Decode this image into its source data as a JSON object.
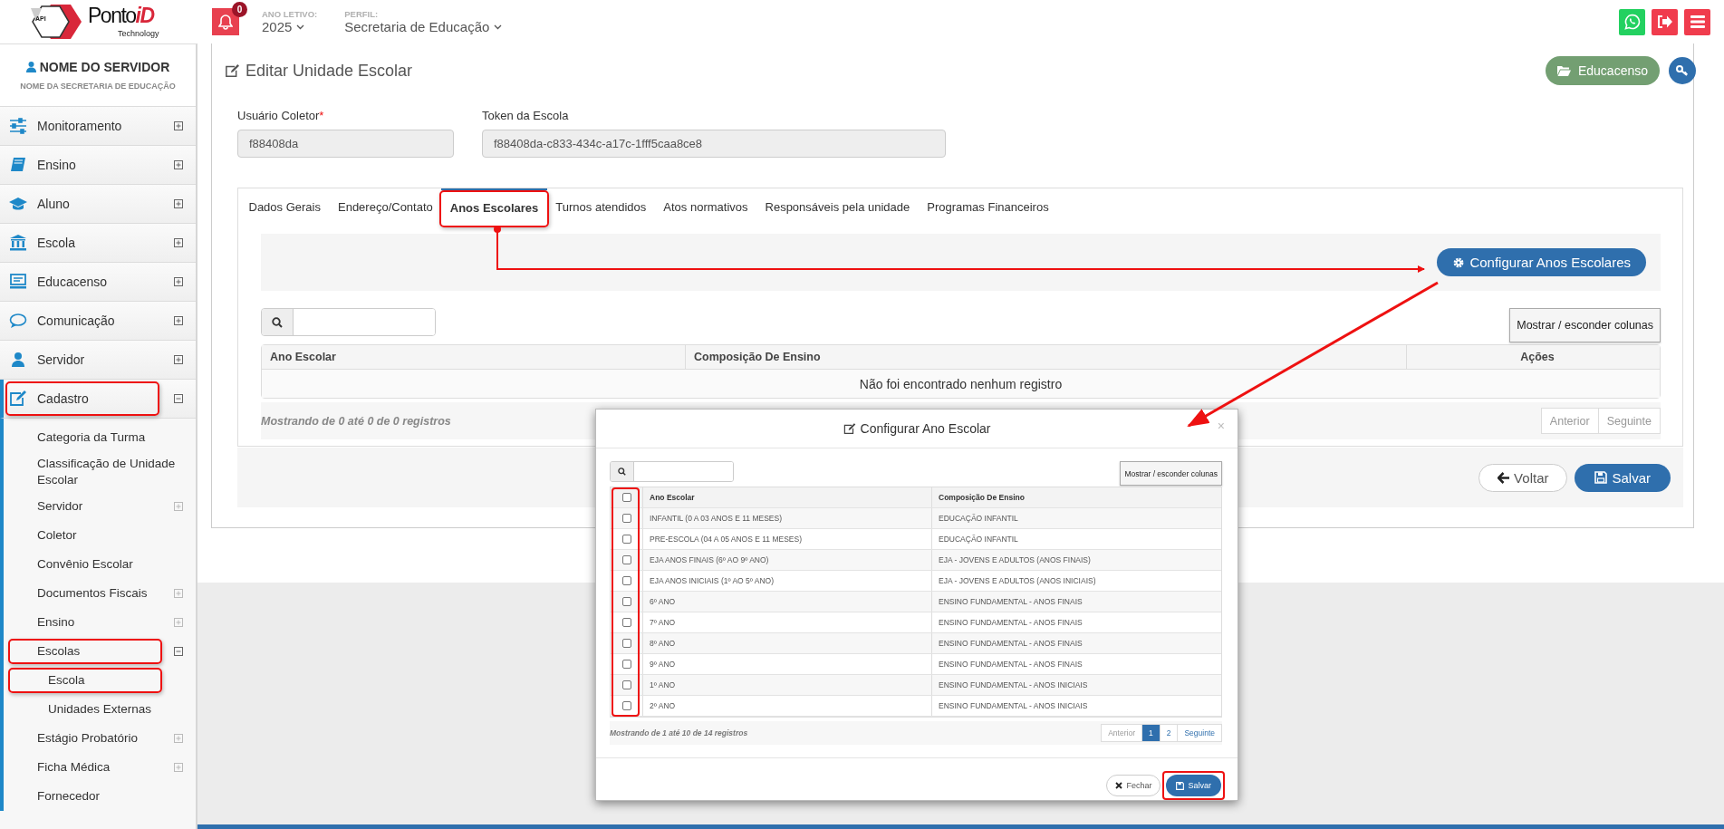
{
  "logo": {
    "badge": "API",
    "word": "Ponto",
    "accent": "iD",
    "tagline": "Technology"
  },
  "notifications": {
    "count": "0"
  },
  "ano_letivo": {
    "label": "ANO LETIVO:",
    "value": "2025"
  },
  "perfil": {
    "label": "PERFIL:",
    "value": "Secretaria de Educação"
  },
  "top_actions": [
    {
      "kind": "whatsapp"
    },
    {
      "kind": "logout"
    },
    {
      "kind": "menu"
    }
  ],
  "user": {
    "name": "NOME DO SERVIDOR",
    "org": "NOME DA SECRETARIA DE EDUCAÇÃO"
  },
  "sidebar": {
    "items": [
      {
        "label": "Monitoramento",
        "kind": "sliders",
        "expanded": false,
        "highlighted": false
      },
      {
        "label": "Ensino",
        "kind": "book",
        "expanded": false,
        "highlighted": false
      },
      {
        "label": "Aluno",
        "kind": "cap",
        "expanded": false,
        "highlighted": false
      },
      {
        "label": "Escola",
        "kind": "bank",
        "expanded": false,
        "highlighted": false
      },
      {
        "label": "Educacenso",
        "kind": "monitor",
        "expanded": false,
        "highlighted": false
      },
      {
        "label": "Comunicação",
        "kind": "chat",
        "expanded": false,
        "highlighted": false
      },
      {
        "label": "Servidor",
        "kind": "user",
        "expanded": false,
        "highlighted": false
      },
      {
        "label": "Cadastro",
        "kind": "edit",
        "expanded": true,
        "highlighted": true,
        "children": [
          {
            "label": "Categoria da Turma",
            "kind": "link",
            "highlighted": false
          },
          {
            "label": "Classificação de Unidade Escolar",
            "kind": "link",
            "highlighted": false
          },
          {
            "label": "Servidor",
            "kind": "group",
            "expanded": false,
            "highlighted": false
          },
          {
            "label": "Coletor",
            "kind": "link",
            "highlighted": false
          },
          {
            "label": "Convênio Escolar",
            "kind": "link",
            "highlighted": false
          },
          {
            "label": "Documentos Fiscais",
            "kind": "group",
            "expanded": false,
            "highlighted": false
          },
          {
            "label": "Ensino",
            "kind": "group",
            "expanded": false,
            "highlighted": false
          },
          {
            "label": "Escolas",
            "kind": "group",
            "expanded": true,
            "highlighted": true,
            "children": [
              {
                "label": "Escola",
                "highlighted": true
              },
              {
                "label": "Unidades Externas",
                "highlighted": false
              }
            ]
          },
          {
            "label": "Estágio Probatório",
            "kind": "group",
            "expanded": false,
            "highlighted": false
          },
          {
            "label": "Ficha Médica",
            "kind": "group",
            "expanded": false,
            "highlighted": false
          },
          {
            "label": "Fornecedor",
            "kind": "link",
            "highlighted": false
          }
        ]
      }
    ]
  },
  "page": {
    "title": "Editar Unidade Escolar",
    "educacenso_button": "Educacenso"
  },
  "fields": [
    {
      "label": "Usuário Coletor",
      "required_mark": "*",
      "value": "f88408da"
    },
    {
      "label": "Token da Escola",
      "value": "f88408da-c833-434c-a17c-1fff5caa8ce8"
    }
  ],
  "tabs": [
    {
      "label": "Dados Gerais",
      "selected": false,
      "highlighted": false
    },
    {
      "label": "Endereço/Contato",
      "selected": false,
      "highlighted": false
    },
    {
      "label": "Anos Escolares",
      "selected": true,
      "highlighted": true
    },
    {
      "label": "Turnos atendidos",
      "selected": false,
      "highlighted": false
    },
    {
      "label": "Atos normativos",
      "selected": false,
      "highlighted": false
    },
    {
      "label": "Responsáveis pela unidade",
      "selected": false,
      "highlighted": false
    },
    {
      "label": "Programas Financeiros",
      "selected": false,
      "highlighted": false
    }
  ],
  "configure_button": "Configurar Anos Escolares",
  "table": {
    "column_toggle": "Mostrar / esconder colunas",
    "columns": [
      "Ano Escolar",
      "Composição De Ensino",
      "Ações"
    ],
    "empty_message": "Não foi encontrado nenhum registro",
    "summary": "Mostrando de 0 até 0 de 0 registros",
    "pagination": [
      {
        "label": "Anterior",
        "selected": false,
        "disabled": true
      },
      {
        "label": "Seguinte",
        "selected": false,
        "disabled": true
      }
    ]
  },
  "form_buttons": [
    {
      "kind": "back",
      "label": "Voltar"
    },
    {
      "kind": "save",
      "label": "Salvar"
    }
  ],
  "modal": {
    "title": "Configurar Ano Escolar",
    "close": "×",
    "column_toggle": "Mostrar / esconder colunas",
    "select_all": {
      "checked": false
    },
    "select_highlighted": true,
    "columns": [
      "Ano Escolar",
      "Composição De Ensino"
    ],
    "rows": [
      {
        "checked": false,
        "cells": [
          "INFANTIL (0 A 03 ANOS E 11 MESES)",
          "EDUCAÇÃO INFANTIL"
        ]
      },
      {
        "checked": false,
        "cells": [
          "PRE-ESCOLA (04 A 05 ANOS E 11 MESES)",
          "EDUCAÇÃO INFANTIL"
        ]
      },
      {
        "checked": false,
        "cells": [
          "EJA ANOS FINAIS (6º AO 9º ANO)",
          "EJA - JOVENS E ADULTOS (ANOS FINAIS)"
        ]
      },
      {
        "checked": false,
        "cells": [
          "EJA ANOS INICIAIS (1º AO 5º ANO)",
          "EJA - JOVENS E ADULTOS (ANOS INICIAIS)"
        ]
      },
      {
        "checked": false,
        "cells": [
          "6º ANO",
          "ENSINO FUNDAMENTAL - ANOS FINAIS"
        ]
      },
      {
        "checked": false,
        "cells": [
          "7º ANO",
          "ENSINO FUNDAMENTAL - ANOS FINAIS"
        ]
      },
      {
        "checked": false,
        "cells": [
          "8º ANO",
          "ENSINO FUNDAMENTAL - ANOS FINAIS"
        ]
      },
      {
        "checked": false,
        "cells": [
          "9º ANO",
          "ENSINO FUNDAMENTAL - ANOS FINAIS"
        ]
      },
      {
        "checked": false,
        "cells": [
          "1º ANO",
          "ENSINO FUNDAMENTAL - ANOS INICIAIS"
        ]
      },
      {
        "checked": false,
        "cells": [
          "2º ANO",
          "ENSINO FUNDAMENTAL - ANOS INICIAIS"
        ]
      }
    ],
    "summary": "Mostrando de 1 até 10 de 14 registros",
    "pagination": [
      {
        "label": "Anterior",
        "selected": false,
        "disabled": true
      },
      {
        "label": "1",
        "selected": true,
        "disabled": false
      },
      {
        "label": "2",
        "selected": false,
        "disabled": false
      },
      {
        "label": "Seguinte",
        "selected": false,
        "disabled": false
      }
    ],
    "buttons": [
      {
        "kind": "close",
        "label": "Fechar",
        "highlighted": false
      },
      {
        "kind": "save",
        "label": "Salvar",
        "highlighted": true
      }
    ]
  }
}
